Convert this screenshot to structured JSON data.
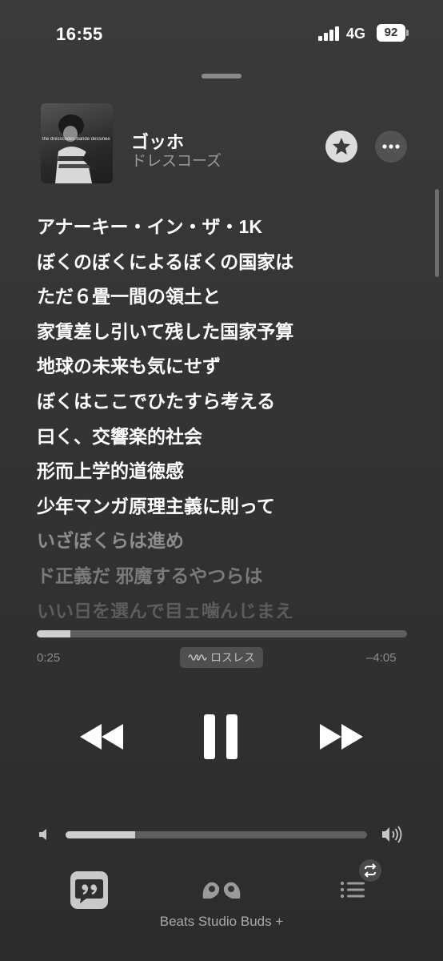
{
  "status_bar": {
    "time": "16:55",
    "network": "4G",
    "battery": "92"
  },
  "now_playing": {
    "album_art_text": "the dresscodes bande dessinée",
    "title": "ゴッホ",
    "artist": "ドレスコーズ"
  },
  "lyrics": [
    {
      "text": "アナーキー・イン・ザ・1K",
      "color": "#ffffff"
    },
    {
      "text": "ぼくのぼくによるぼくの国家は",
      "color": "#ffffff"
    },
    {
      "text": "ただ６畳一間の領土と",
      "color": "#ffffff"
    },
    {
      "text": "家賃差し引いて残した国家予算",
      "color": "#ffffff"
    },
    {
      "text": "地球の未来も気にせず",
      "color": "#ffffff"
    },
    {
      "text": "ぼくはここでひたすら考える",
      "color": "#ffffff"
    },
    {
      "text": "曰く、交響楽的社会",
      "color": "#ffffff"
    },
    {
      "text": "形而上学的道徳感",
      "color": "#ffffff"
    },
    {
      "text": "少年マンガ原理主義に則って",
      "color": "#ffffff"
    },
    {
      "text": "いざぼくらは進め",
      "color": "#8d8d8d"
    },
    {
      "text": "ド正義だ 邪魔するやつらは",
      "color": "#7a7a7a"
    },
    {
      "text": "いい日を選んで目ェ噛んじまえ",
      "color": "#5c5c5c"
    }
  ],
  "playback": {
    "elapsed": "0:25",
    "remaining": "–4:05",
    "progress_fraction": 0.09,
    "quality_badge": "ロスレス"
  },
  "volume": {
    "level_fraction": 0.23
  },
  "bottom_bar": {
    "output_device": "Beats Studio Buds +"
  },
  "icons": {
    "star": "star-icon",
    "more": "ellipsis-icon",
    "lossless": "lossless-waveform-icon",
    "previous": "rewind-icon",
    "pause": "pause-icon",
    "next": "fast-forward-icon",
    "volume_low": "speaker-low-icon",
    "volume_high": "speaker-high-icon",
    "lyrics": "lyrics-quote-icon",
    "airplay": "earbuds-icon",
    "queue": "queue-list-icon",
    "repeat": "repeat-icon"
  },
  "colors": {
    "background": "#333333",
    "primary_text": "#ffffff",
    "secondary_text": "#9a9a9a"
  }
}
